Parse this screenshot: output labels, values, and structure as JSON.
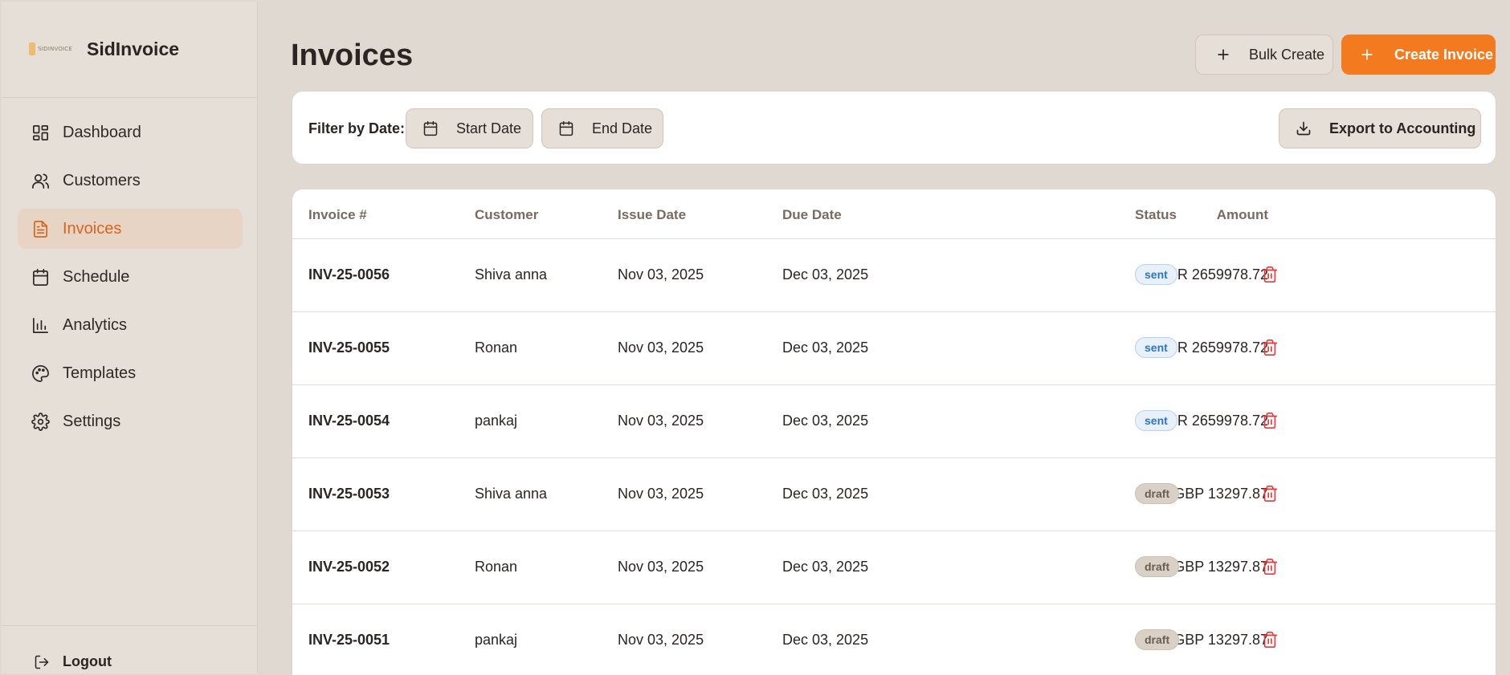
{
  "brand": {
    "logo_text": "SIDINVOICE",
    "name": "SidInvoice"
  },
  "sidebar": {
    "items": [
      {
        "label": "Dashboard",
        "icon": "dashboard-icon"
      },
      {
        "label": "Customers",
        "icon": "users-icon"
      },
      {
        "label": "Invoices",
        "icon": "file-text-icon"
      },
      {
        "label": "Schedule",
        "icon": "calendar-icon"
      },
      {
        "label": "Analytics",
        "icon": "bar-chart-icon"
      },
      {
        "label": "Templates",
        "icon": "palette-icon"
      },
      {
        "label": "Settings",
        "icon": "gear-icon"
      }
    ],
    "active": "Invoices",
    "logout_label": "Logout"
  },
  "header": {
    "title": "Invoices",
    "bulk_create_label": "Bulk Create",
    "create_invoice_label": "Create Invoice"
  },
  "filter": {
    "label": "Filter by Date:",
    "start_label": "Start Date",
    "end_label": "End Date",
    "export_label": "Export to Accounting"
  },
  "table": {
    "columns": [
      "Invoice #",
      "Customer",
      "Issue Date",
      "Due Date",
      "Amount",
      "Status"
    ],
    "rows": [
      {
        "number": "INV-25-0056",
        "customer": "Shiva anna",
        "issue": "Nov 03, 2025",
        "due": "Dec 03, 2025",
        "amount": "INR 2659978.72",
        "status": "sent"
      },
      {
        "number": "INV-25-0055",
        "customer": "Ronan",
        "issue": "Nov 03, 2025",
        "due": "Dec 03, 2025",
        "amount": "INR 2659978.72",
        "status": "sent"
      },
      {
        "number": "INV-25-0054",
        "customer": "pankaj",
        "issue": "Nov 03, 2025",
        "due": "Dec 03, 2025",
        "amount": "INR 2659978.72",
        "status": "sent"
      },
      {
        "number": "INV-25-0053",
        "customer": "Shiva anna",
        "issue": "Nov 03, 2025",
        "due": "Dec 03, 2025",
        "amount": "GBP 13297.87",
        "status": "draft"
      },
      {
        "number": "INV-25-0052",
        "customer": "Ronan",
        "issue": "Nov 03, 2025",
        "due": "Dec 03, 2025",
        "amount": "GBP 13297.87",
        "status": "draft"
      },
      {
        "number": "INV-25-0051",
        "customer": "pankaj",
        "issue": "Nov 03, 2025",
        "due": "Dec 03, 2025",
        "amount": "GBP 13297.87",
        "status": "draft"
      }
    ]
  },
  "colors": {
    "accent": "#f47a1f",
    "active_nav_text": "#d2671f",
    "active_nav_bg": "#e8d4c4",
    "delete": "#e03a3a",
    "sent_badge": "#2f73c8",
    "draft_badge_bg": "#d9d0c6"
  }
}
